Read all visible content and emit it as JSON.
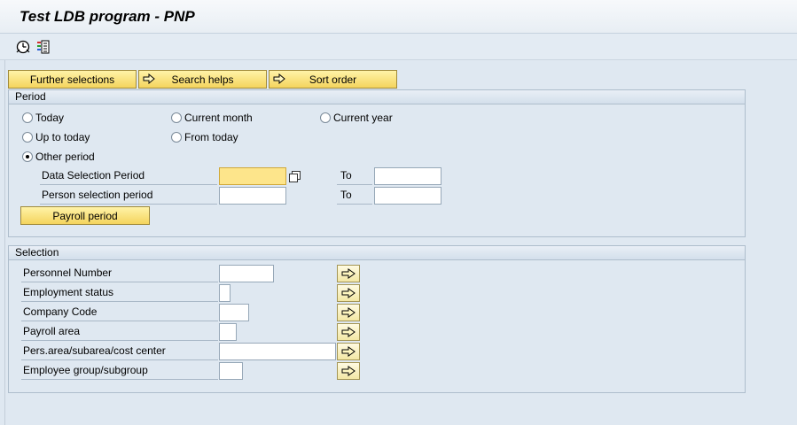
{
  "window": {
    "title": "Test LDB program - PNP"
  },
  "toolbar": {
    "icons": [
      "execute-clock-icon",
      "selection-options-icon"
    ]
  },
  "tabs": {
    "further_selections": "Further selections",
    "search_helps": "Search helps",
    "sort_order": "Sort order"
  },
  "period": {
    "header": "Period",
    "options": {
      "today": "Today",
      "current_month": "Current month",
      "current_year": "Current year",
      "up_to_today": "Up to today",
      "from_today": "From today",
      "other_period": "Other period"
    },
    "selected": "other_period",
    "data_selection_label": "Data Selection Period",
    "data_selection_from": "",
    "data_selection_to": "",
    "person_selection_label": "Person selection period",
    "person_selection_from": "",
    "person_selection_to": "",
    "to_label": "To",
    "payroll_button": "Payroll period"
  },
  "selection": {
    "header": "Selection",
    "fields": {
      "personnel_number": {
        "label": "Personnel Number",
        "value": ""
      },
      "employment_status": {
        "label": "Employment status",
        "value": ""
      },
      "company_code": {
        "label": "Company Code",
        "value": ""
      },
      "payroll_area": {
        "label": "Payroll area",
        "value": ""
      },
      "pers_area": {
        "label": "Pers.area/subarea/cost center",
        "value": ""
      },
      "employee_group": {
        "label": "Employee group/subgroup",
        "value": ""
      }
    }
  },
  "colors": {
    "background": "#dfe8f1",
    "button_yellow": "#f4d45d",
    "active_field": "#fde58b",
    "required_marker": "#c9252c"
  }
}
